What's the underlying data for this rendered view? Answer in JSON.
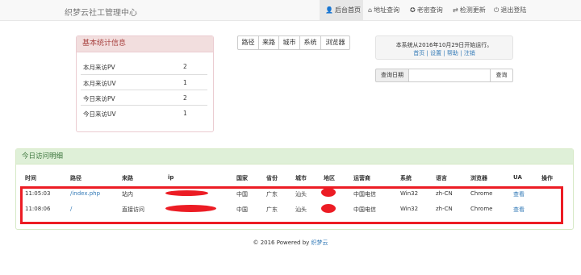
{
  "navbar": {
    "brand": "织梦云社工管理中心",
    "items": [
      {
        "label": "后台首页",
        "icon": "user-icon",
        "glyph": "👤",
        "active": true
      },
      {
        "label": "地址查询",
        "icon": "home-icon",
        "glyph": "⌂",
        "active": false
      },
      {
        "label": "老密查询",
        "icon": "search-icon",
        "glyph": "✪",
        "active": false
      },
      {
        "label": "检测更新",
        "icon": "retweet-icon",
        "glyph": "⇄",
        "active": false
      },
      {
        "label": "退出登陆",
        "icon": "logout-icon",
        "glyph": "⏻",
        "active": false
      }
    ]
  },
  "stats": {
    "title": "基本统计信息",
    "rows": [
      {
        "label": "本月来访PV",
        "value": "2"
      },
      {
        "label": "本月来访UV",
        "value": "1"
      },
      {
        "label": "今日来访PV",
        "value": "2"
      },
      {
        "label": "今日来访UV",
        "value": "1"
      }
    ]
  },
  "filter_buttons": [
    "路径",
    "来路",
    "城市",
    "系统",
    "浏览器"
  ],
  "notice": {
    "text": "本系统从2016年10月29日开始运行。",
    "links": "首页 | 设置 | 帮助 | 注销"
  },
  "query": {
    "label": "查询日期",
    "button": "查询"
  },
  "visits": {
    "title": "今日访问明细",
    "columns": [
      "时间",
      "路径",
      "来路",
      "ip",
      "国家",
      "省份",
      "城市",
      "地区",
      "运营商",
      "系统",
      "语言",
      "浏览器",
      "UA",
      "操作"
    ],
    "rows": [
      {
        "time": "11:05:03",
        "path": "/index.php",
        "referrer": "站内",
        "ip": "",
        "country": "中国",
        "province": "广东",
        "city": "汕头",
        "region": "",
        "isp": "中国电信",
        "os": "Win32",
        "lang": "zh-CN",
        "browser": "Chrome",
        "ua": "查看"
      },
      {
        "time": "11:08:06",
        "path": "/",
        "referrer": "直接访问",
        "ip": "",
        "country": "中国",
        "province": "广东",
        "city": "汕头",
        "region": "",
        "isp": "中国电信",
        "os": "Win32",
        "lang": "zh-CN",
        "browser": "Chrome",
        "ua": "查看"
      }
    ]
  },
  "footer": {
    "text": "© 2016 Powered by ",
    "link": "织梦云"
  },
  "colors": {
    "annotation_red": "#ec1c24",
    "link_blue": "#337ab7",
    "stats_header_bg": "#f2dede",
    "visits_header_bg": "#dff0d8"
  }
}
